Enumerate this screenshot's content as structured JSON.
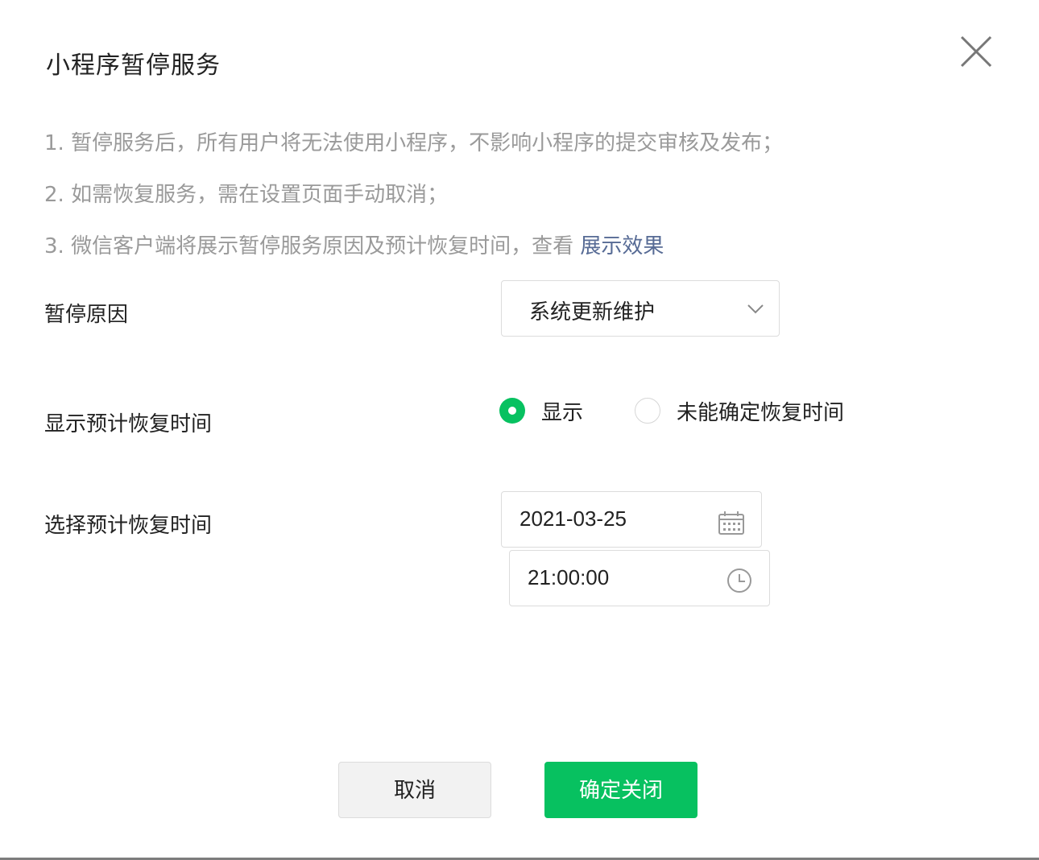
{
  "dialog": {
    "title": "小程序暂停服务",
    "tips": [
      "1.  暂停服务后，所有用户将无法使用小程序，不影响小程序的提交审核及发布；",
      "2.  如需恢复服务，需在设置页面手动取消；",
      "3.  微信客户端将展示暂停服务原因及预计恢复时间，查看 "
    ],
    "tips_link": "展示效果"
  },
  "form": {
    "reason_label": "暂停原因",
    "reason_value": "系统更新维护",
    "show_time_label": "显示预计恢复时间",
    "radio_show": "显示",
    "radio_unknown": "未能确定恢复时间",
    "select_time_label": "选择预计恢复时间",
    "date_value": "2021-03-25",
    "time_value": "21:00:00"
  },
  "actions": {
    "cancel": "取消",
    "confirm": "确定关闭"
  },
  "colors": {
    "primary": "#07c160",
    "link": "#576b95",
    "tip_text": "#9a9a9a"
  },
  "icons": {
    "close": "close-icon",
    "dropdown": "chevron-down-icon",
    "calendar": "calendar-icon",
    "clock": "clock-icon"
  }
}
